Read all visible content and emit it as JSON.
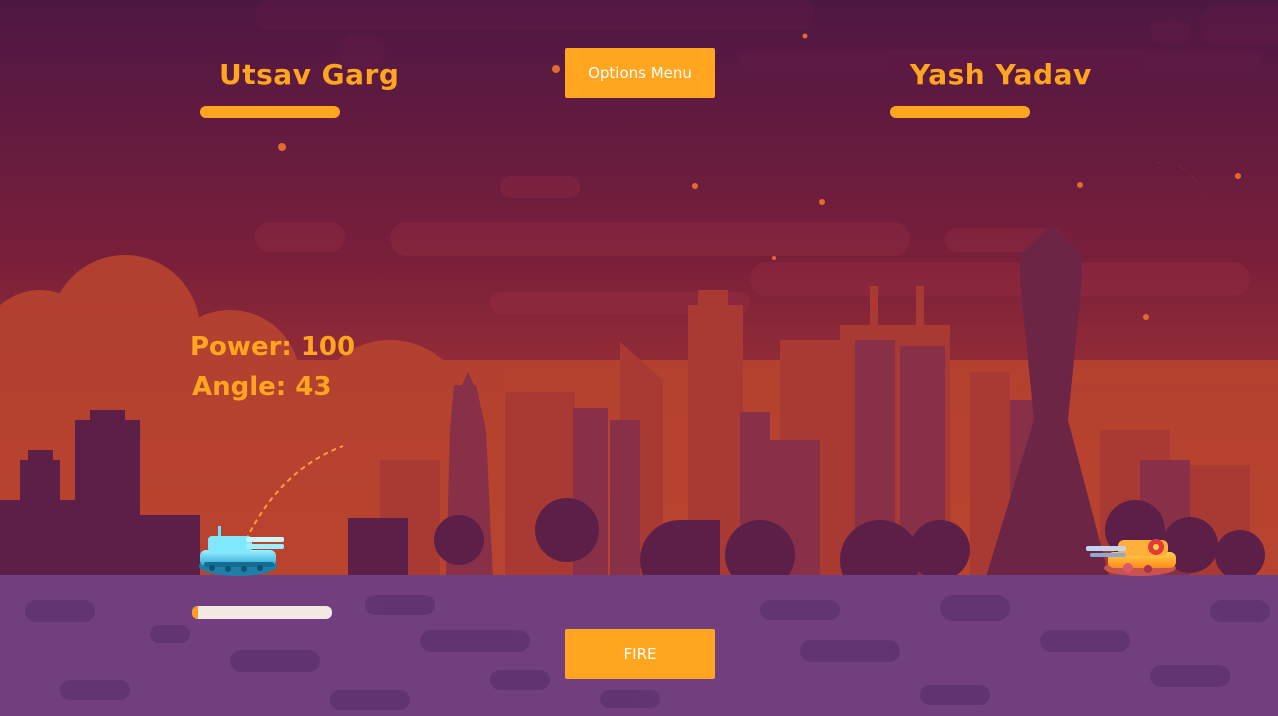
{
  "players": {
    "left": {
      "name": "Utsav Garg",
      "health": 1.0
    },
    "right": {
      "name": "Yash Yadav",
      "health": 1.0
    }
  },
  "buttons": {
    "options_label": "Options Menu",
    "fire_label": "FIRE"
  },
  "controls": {
    "power_text": "Power: 100",
    "angle_text": "Angle: 43",
    "power_meter_level": 0.04
  },
  "colors": {
    "accent": "#ffa51f",
    "sky_top": "#4d1744",
    "sky_bottom": "#c4462f",
    "ground": "#713f80"
  },
  "icons": {
    "player_tank": "blue-tank-icon",
    "enemy_tank": "orange-tank-icon",
    "moon": "crescent-moon-icon"
  }
}
